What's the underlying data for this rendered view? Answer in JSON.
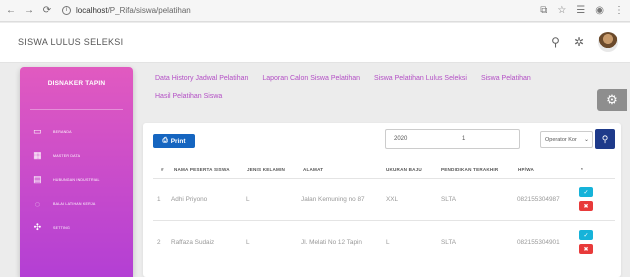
{
  "browser": {
    "back_icon": "arrow-left-icon",
    "forward_icon": "arrow-right-icon",
    "reload_icon": "reload-icon",
    "url_host": "localhost",
    "url_path": "/P_Rifa/siswa/pelatihan"
  },
  "header": {
    "title": "SISWA LULUS SELEKSI"
  },
  "sidebar": {
    "title": "DISNAKER TAPIN",
    "items": [
      {
        "label": "BERANDA",
        "icon": "monitor-icon"
      },
      {
        "label": "MASTER DATA",
        "icon": "data-icon"
      },
      {
        "label": "HUBUNGAN INDUSTRIAL",
        "icon": "document-icon"
      },
      {
        "label": "BALAI LATIHAN KERJA",
        "icon": "chat-icon"
      },
      {
        "label": "SETTING",
        "icon": "gear-icon"
      }
    ]
  },
  "topnav": {
    "links": [
      "Data History Jadwal Pelatihan",
      "Laporan Calon Siswa Pelatihan",
      "Siswa Pelatihan Lulus Seleksi",
      "Siswa Pelatihan",
      "Hasil Pelatihan Siswa"
    ]
  },
  "toolbar": {
    "print_label": "Print",
    "year_value": "2020",
    "num_value": "1",
    "operator_value": "Operator Kor"
  },
  "table": {
    "headers": [
      "#",
      "NAMA PESERTA SISWA",
      "JENIS KELAMIN",
      "ALAMAT",
      "UKURAN BAJU",
      "PENDIDIKAN TERAKHIR",
      "HP/WA",
      "*"
    ],
    "rows": [
      {
        "no": "1",
        "nama": "Adhi Priyono",
        "jk": "L",
        "alamat": "Jalan Kemuning no 87",
        "ukuran": "XXL",
        "pendidikan": "SLTA",
        "hp": "082155304987"
      },
      {
        "no": "2",
        "nama": "Raffaza Sudaiz",
        "jk": "L",
        "alamat": "Jl. Melati No 12 Tapin",
        "ukuran": "L",
        "pendidikan": "SLTA",
        "hp": "082155304901"
      }
    ]
  },
  "colors": {
    "sidebar_top": "#e15ac0",
    "sidebar_bottom": "#b33fd4",
    "print_btn": "#1565c0",
    "check_btn": "#16b3d9",
    "delete_btn": "#e83a3a"
  }
}
